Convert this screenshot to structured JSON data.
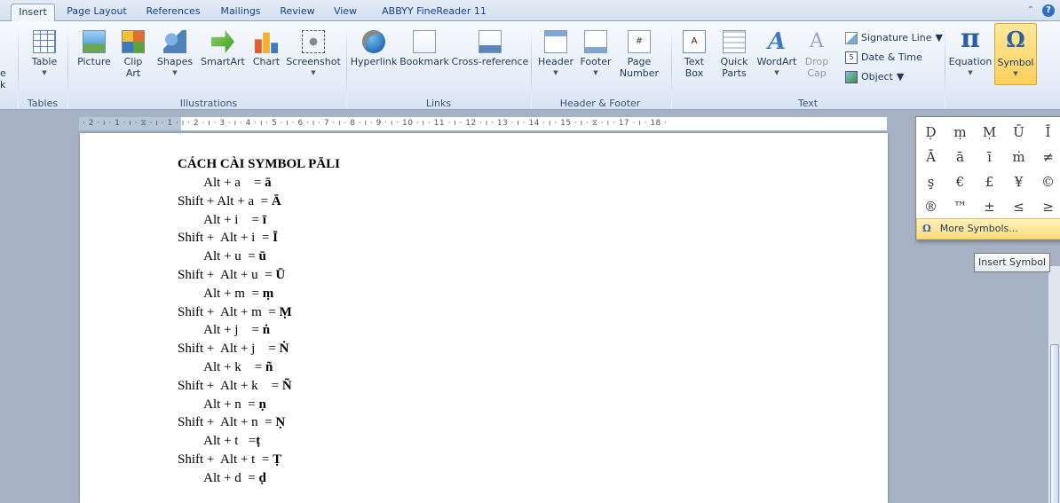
{
  "tabs": [
    "Insert",
    "Page Layout",
    "References",
    "Mailings",
    "Review",
    "View",
    "ABBYY FineReader 11"
  ],
  "ribbon": {
    "cut_left": {
      "top": "e",
      "bottom": "k"
    },
    "tables": {
      "table": "Table",
      "group": "Tables"
    },
    "illustrations": {
      "picture": "Picture",
      "clipart": "Clip Art",
      "shapes": "Shapes",
      "smartart": "SmartArt",
      "chart": "Chart",
      "screenshot": "Screenshot",
      "group": "Illustrations"
    },
    "links": {
      "hyperlink": "Hyperlink",
      "bookmark": "Bookmark",
      "crossref": "Cross-reference",
      "group": "Links"
    },
    "header_footer": {
      "header": "Header",
      "footer": "Footer",
      "pagenum": "Page Number",
      "group": "Header & Footer"
    },
    "text": {
      "textbox": "Text Box",
      "quickparts": "Quick Parts",
      "wordart": "WordArt",
      "dropcap": "Drop Cap",
      "signature": "Signature Line",
      "date": "Date & Time",
      "object": "Object",
      "group": "Text"
    },
    "symbols": {
      "equation": "Equation",
      "symbol": "Symbol",
      "pi_glyph": "π",
      "omega_glyph": "Ω"
    }
  },
  "ruler_text": "· 2 · ı · 1 · ı · ⧖ · ı · 1 · ı · 2 · ı · 3 · ı · 4 · ı · 5 · ı · 6 · ı · 7 · ı · 8 · ı · 9 · ı · 10 · ı · 11 · ı · 12 · ı · 13 · ı · 14 · ı · 15 · ı · ⧖ · ı · 17 · ı · 18 ·",
  "document": {
    "title": "CÁCH CÀI SYMBOL PĀLI",
    "lines": [
      {
        "prefix": "        Alt + a    = ",
        "symbol": "ā"
      },
      {
        "prefix": "Shift + Alt + a  = ",
        "symbol": "Ā"
      },
      {
        "prefix": "        Alt + i    = ",
        "symbol": "ī"
      },
      {
        "prefix": "Shift +  Alt + i  = ",
        "symbol": "Ī"
      },
      {
        "prefix": "        Alt + u  = ",
        "symbol": "ū"
      },
      {
        "prefix": "Shift +  Alt + u  = ",
        "symbol": "Ū"
      },
      {
        "prefix": "        Alt + m  = ",
        "symbol": "ṃ"
      },
      {
        "prefix": "Shift +  Alt + m  = ",
        "symbol": "Ṃ"
      },
      {
        "prefix": "        Alt + j    = ",
        "symbol": "ṅ"
      },
      {
        "prefix": "Shift +  Alt + j    = ",
        "symbol": "Ṅ"
      },
      {
        "prefix": "        Alt + k    = ",
        "symbol": "ñ"
      },
      {
        "prefix": "Shift +  Alt + k    = ",
        "symbol": "Ñ"
      },
      {
        "prefix": "        Alt + n  = ",
        "symbol": "ṇ"
      },
      {
        "prefix": "Shift +  Alt + n  = ",
        "symbol": "Ṇ"
      },
      {
        "prefix": "        Alt + t   =",
        "symbol": "ṭ"
      },
      {
        "prefix": "Shift +  Alt + t  = ",
        "symbol": "Ṭ"
      },
      {
        "prefix": "        Alt + d  = ",
        "symbol": "ḍ"
      }
    ]
  },
  "symbol_panel": {
    "symbols": [
      "Ḍ",
      "ṃ",
      "Ṃ",
      "Ū",
      "Ī",
      "Ā",
      "ā",
      "ī",
      "ṁ",
      "≠",
      "ş",
      "€",
      "£",
      "¥",
      "©",
      "®",
      "™",
      "±",
      "≤",
      "≥"
    ],
    "more_prefix": "Ω",
    "more_label": "More Symbols...",
    "tooltip": "Insert Symbol"
  },
  "help_glyph": "?",
  "minimize_glyph": "⌃"
}
